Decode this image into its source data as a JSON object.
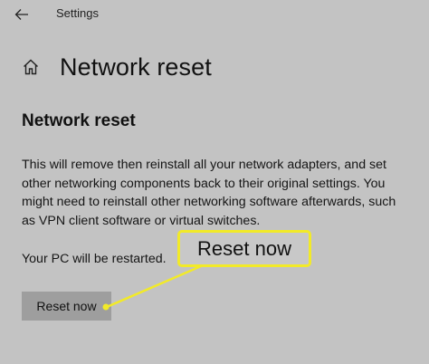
{
  "window": {
    "app_title": "Settings"
  },
  "header": {
    "title": "Network reset"
  },
  "section": {
    "title": "Network reset",
    "description": "This will remove then reinstall all your network adapters, and set\nother networking components back to their original settings. You\nmight need to reinstall other networking software afterwards, such\nas VPN client software or virtual switches.",
    "restart_note": "Your PC will be restarted."
  },
  "actions": {
    "reset_label": "Reset now"
  },
  "callout": {
    "label": "Reset now",
    "color": "#f2ea28"
  },
  "colors": {
    "background": "#c3c3c3",
    "button": "#9e9e9e",
    "highlight": "#f2ea28"
  },
  "icons": {
    "back": "back-arrow-icon",
    "home": "home-icon"
  }
}
